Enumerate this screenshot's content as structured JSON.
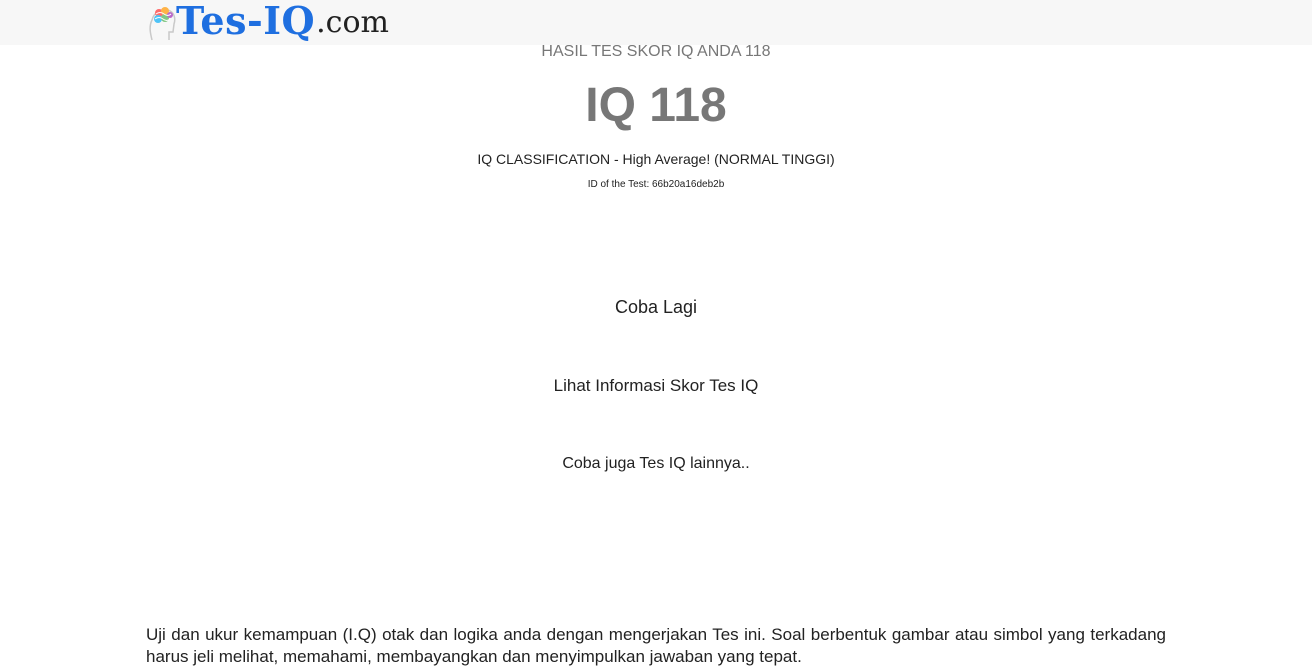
{
  "header": {
    "logo_main": "Tes-IQ",
    "logo_suffix": ".com"
  },
  "result": {
    "heading": "HASIL TES SKOR IQ ANDA 118",
    "score": "IQ 118",
    "classification": "IQ CLASSIFICATION - High Average! (NORMAL TINGGI)",
    "test_id": "ID of the Test: 66b20a16deb2b"
  },
  "links": {
    "retry": "Coba Lagi",
    "info": "Lihat Informasi Skor Tes IQ",
    "other_tests": "Coba juga Tes IQ lainnya.."
  },
  "description": "Uji dan ukur kemampuan (I.Q) otak dan logika anda dengan mengerjakan Tes ini. Soal berbentuk gambar atau simbol yang terkadang harus jeli melihat, memahami, membayangkan dan menyimpulkan jawaban yang tepat.",
  "icons": {
    "logo_icon": "brain-head-icon"
  },
  "colors": {
    "brand_blue": "#1f6fe0",
    "topbar_bg": "#f7f7f7",
    "muted_text": "#777777"
  }
}
